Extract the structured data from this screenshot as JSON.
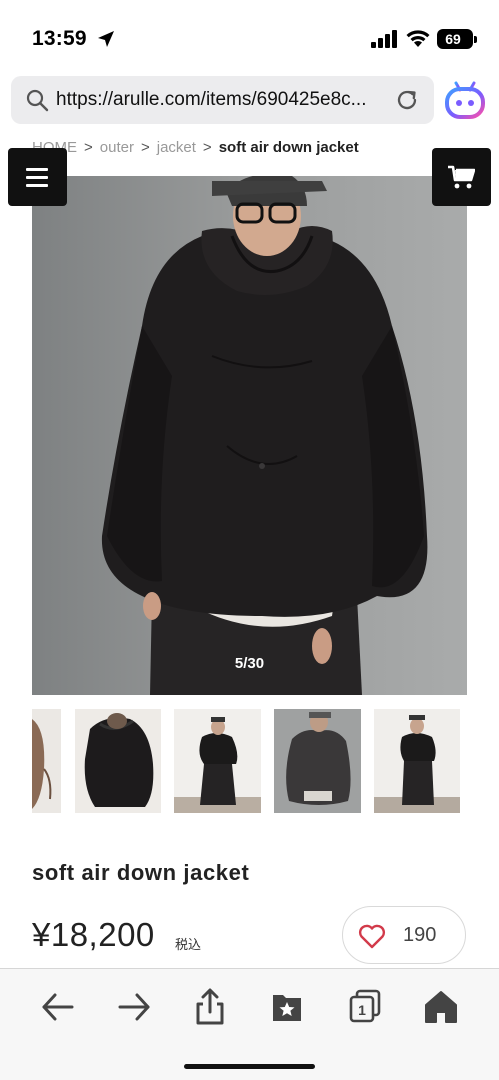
{
  "status_bar": {
    "time": "13:59",
    "battery": "69",
    "icons": [
      "location-arrow-icon",
      "cellular-signal-icon",
      "wifi-icon",
      "battery-icon"
    ]
  },
  "browser": {
    "url": "https://arulle.com/items/690425e8c...",
    "icons": [
      "search-icon",
      "reload-icon",
      "assistant-icon"
    ]
  },
  "breadcrumb": {
    "items": [
      "HOME",
      "outer",
      "jacket"
    ],
    "current": "soft air down jacket",
    "separator": ">"
  },
  "header": {
    "menu_icon": "hamburger-menu-icon",
    "cart_icon": "shopping-cart-icon"
  },
  "gallery": {
    "counter": "5/30",
    "thumbnail_count_visible": 5
  },
  "product": {
    "name": "soft air down jacket",
    "price": "¥18,200",
    "tax_label": "税込",
    "likes": "190"
  },
  "toolbar": {
    "icons": [
      "back-arrow-icon",
      "forward-arrow-icon",
      "share-icon",
      "bookmarks-icon",
      "tabs-icon",
      "home-icon"
    ],
    "tabs_count": "1"
  },
  "colors": {
    "accent_red": "#d23a4a",
    "dark_button": "#111111",
    "jacket": "#1f1d1e"
  }
}
